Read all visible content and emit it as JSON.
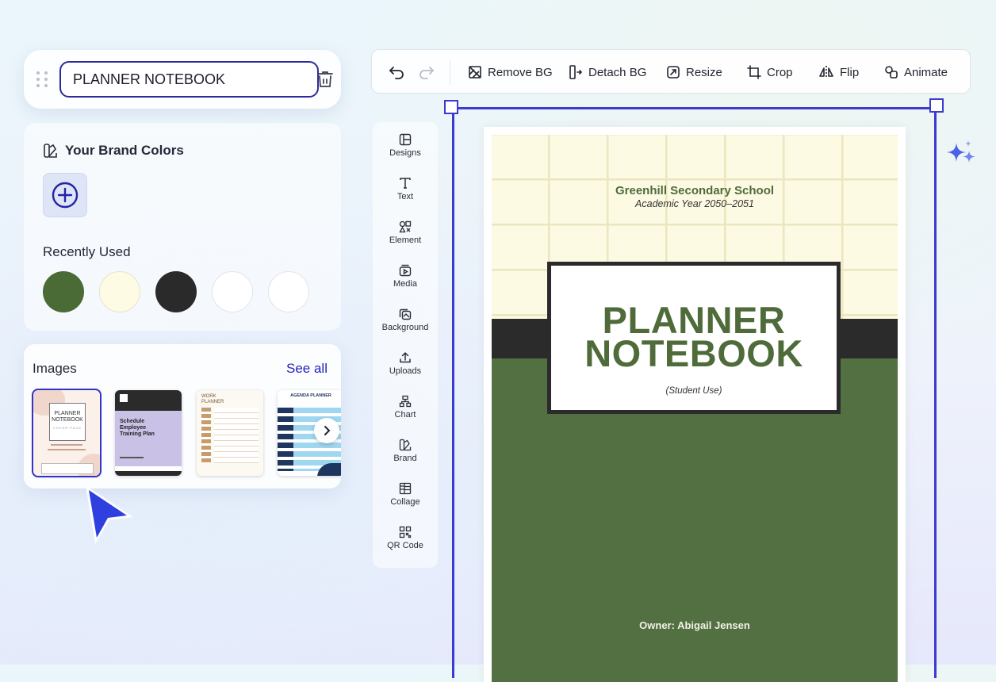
{
  "title_card": {
    "value": "PLANNER NOTEBOOK"
  },
  "brand": {
    "title": "Your Brand Colors",
    "recent_title": "Recently Used",
    "swatches": [
      "#4a6b35",
      "#fdfbe3",
      "#2a2a2a",
      "#ffffff",
      "#ffffff"
    ]
  },
  "images": {
    "title": "Images",
    "see_all": "See all",
    "thumb1": {
      "title": "PLANNER NOTEBOOK",
      "sub": "COVER PAGE"
    },
    "thumb2": {
      "title": "Schedule Employee Training Plan"
    },
    "thumb3": {
      "title": "WORK PLANNER"
    },
    "thumb4": {
      "title": "AGENDA PLANNER"
    }
  },
  "toolbar": {
    "remove_bg": "Remove BG",
    "detach_bg": "Detach BG",
    "resize": "Resize",
    "crop": "Crop",
    "flip": "Flip",
    "animate": "Animate"
  },
  "tools": [
    "Designs",
    "Text",
    "Element",
    "Media",
    "Background",
    "Uploads",
    "Chart",
    "Brand",
    "Collage",
    "QR Code"
  ],
  "page": {
    "school": "Greenhill Secondary School",
    "year": "Academic Year 2050–2051",
    "title_line1": "PLANNER",
    "title_line2": "NOTEBOOK",
    "subtitle": "(Student Use)",
    "owner": "Owner: Abigail Jensen"
  },
  "colors": {
    "accent": "#3b3bd0",
    "green": "#527041",
    "cream": "#fcfae2",
    "dark": "#2b2b2b"
  }
}
